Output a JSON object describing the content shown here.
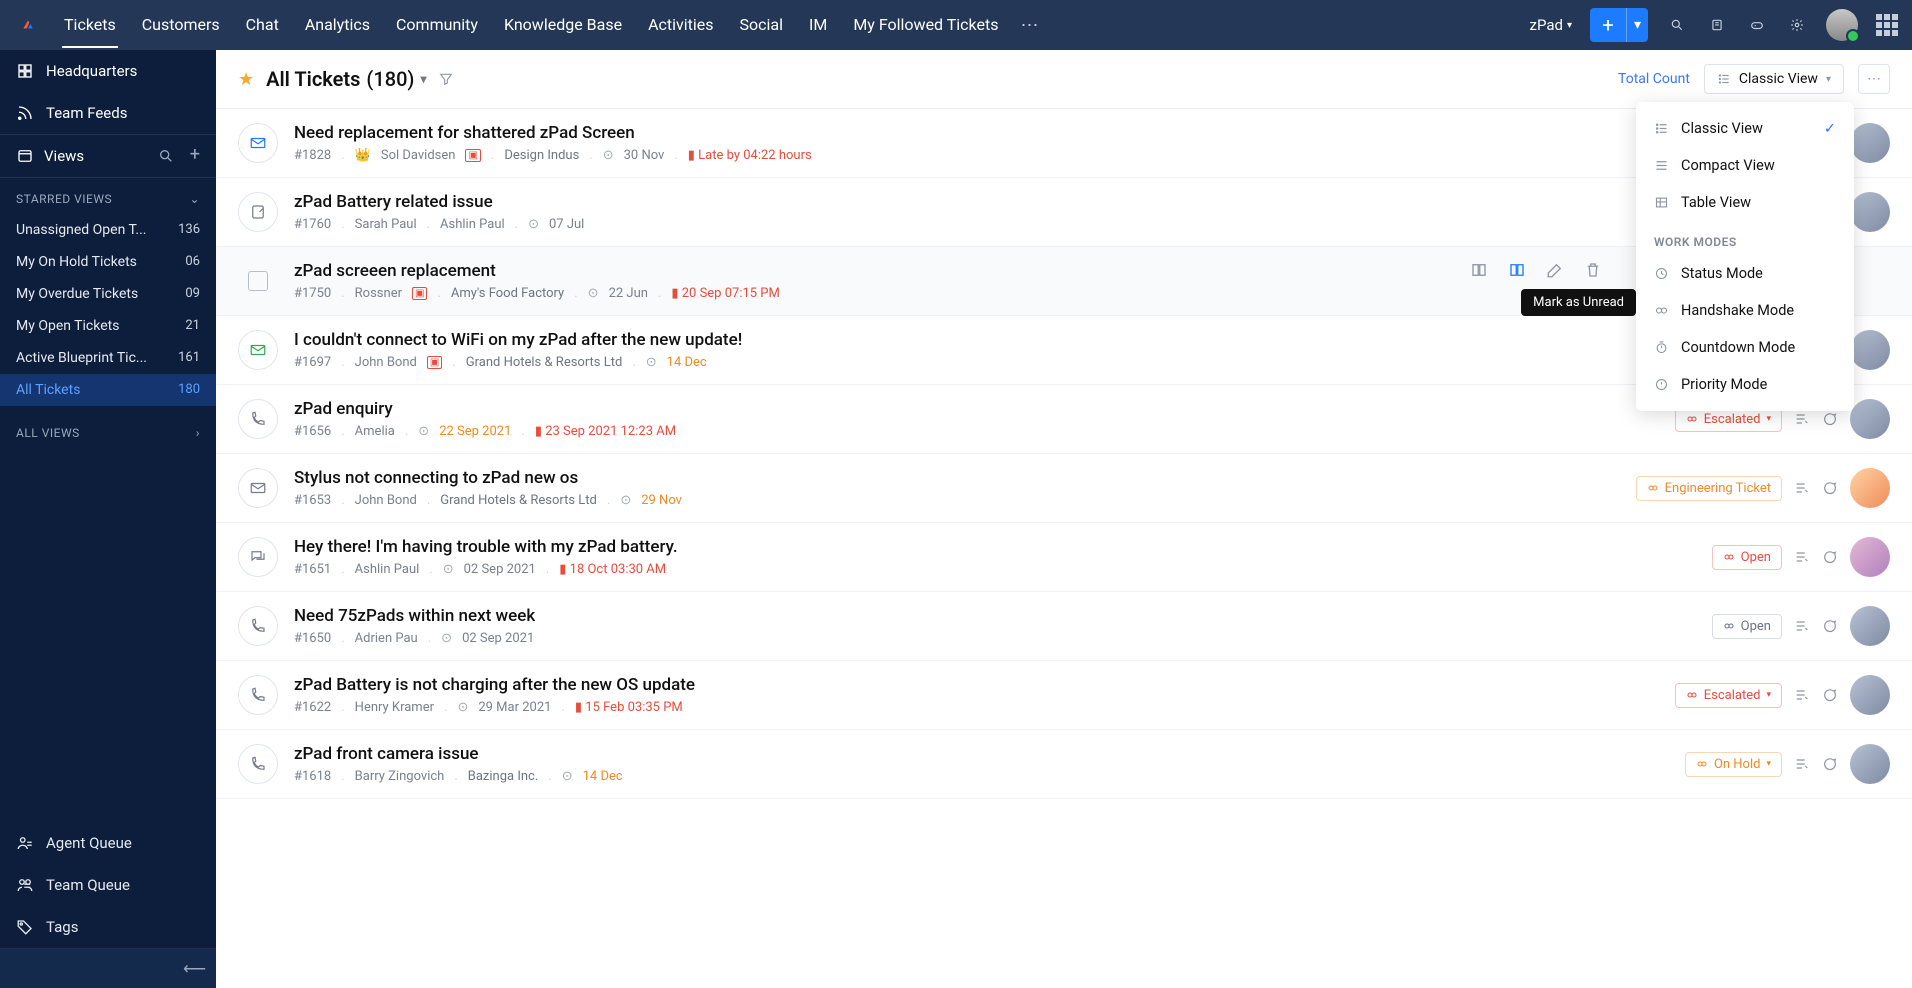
{
  "topnav": [
    "Tickets",
    "Customers",
    "Chat",
    "Analytics",
    "Community",
    "Knowledge Base",
    "Activities",
    "Social",
    "IM",
    "My Followed Tickets"
  ],
  "department": "zPad",
  "sidebar": {
    "hq": "Headquarters",
    "teamfeeds": "Team Feeds",
    "views": "Views",
    "starred_title": "STARRED VIEWS",
    "allviews_title": "ALL VIEWS",
    "starred": [
      {
        "label": "Unassigned Open T...",
        "count": "136"
      },
      {
        "label": "My On Hold Tickets",
        "count": "06"
      },
      {
        "label": "My Overdue Tickets",
        "count": "09"
      },
      {
        "label": "My Open Tickets",
        "count": "21"
      },
      {
        "label": "Active Blueprint Tic...",
        "count": "161"
      },
      {
        "label": "All Tickets",
        "count": "180",
        "active": true
      }
    ],
    "bottom": {
      "agentq": "Agent Queue",
      "teamq": "Team Queue",
      "tags": "Tags"
    }
  },
  "header": {
    "title": "All Tickets",
    "count": "(180)",
    "totalcount": "Total Count",
    "viewbtn": "Classic View"
  },
  "dropdown": {
    "classic": "Classic View",
    "compact": "Compact View",
    "table": "Table View",
    "work_title": "WORK MODES",
    "status": "Status Mode",
    "handshake": "Handshake Mode",
    "countdown": "Countdown Mode",
    "priority": "Priority Mode"
  },
  "tooltip": "Mark as Unread",
  "tickets": [
    {
      "icon": "mail-blue",
      "subj": "Need replacement for shattered zPad Screen",
      "id": "#1828",
      "vip": true,
      "person": "Sol Davidsen",
      "pflag": true,
      "org": "Design Indus",
      "date": "30 Nov",
      "due": "Late by 04:22 hours"
    },
    {
      "icon": "note",
      "subj": "zPad Battery related issue",
      "id": "#1760",
      "person": "Sarah Paul",
      "extra": "Ashlin Paul",
      "date": "07 Jul"
    },
    {
      "icon": "check",
      "hovered": true,
      "subj": "zPad screeen replacement",
      "id": "#1750",
      "person": "Rossner",
      "pflag": true,
      "org": "Amy's Food Factory",
      "date": "22 Jun",
      "due": "20 Sep 07:15 PM",
      "tools": true
    },
    {
      "icon": "mail-green",
      "subj": "I couldn't connect to WiFi on my zPad after the new update!",
      "id": "#1697",
      "person": "John Bond",
      "pflag": true,
      "org": "Grand Hotels & Resorts Ltd",
      "date": "14 Dec",
      "dateclr": "orange"
    },
    {
      "icon": "phone",
      "subj": "zPad enquiry",
      "id": "#1656",
      "person": "Amelia",
      "date": "22 Sep 2021",
      "dateclr": "orange",
      "due": "23 Sep 2021 12:23 AM",
      "badge": "Escalated",
      "badgecls": "escalated",
      "drop": true
    },
    {
      "icon": "mail",
      "subj": "Stylus not connecting to zPad new os",
      "id": "#1653",
      "person": "John Bond",
      "org": "Grand Hotels & Resorts Ltd",
      "date": "29 Nov",
      "dateclr": "orange",
      "badge": "Engineering Ticket",
      "badgecls": "eng",
      "avatarcls": "f1"
    },
    {
      "icon": "chat",
      "subj": "Hey there! I'm having trouble with my zPad battery.",
      "id": "#1651",
      "person": "Ashlin Paul",
      "date": "02 Sep 2021",
      "due": "18 Oct 03:30 AM",
      "badge": "Open",
      "badgecls": "open",
      "avatarcls": "f2"
    },
    {
      "icon": "phone",
      "subj": "Need 75zPads within next week",
      "id": "#1650",
      "person": "Adrien Pau",
      "date": "02 Sep 2021",
      "badge": "Open",
      "badgecls": "open-grey"
    },
    {
      "icon": "phone",
      "subj": "zPad Battery is not charging after the new OS update",
      "id": "#1622",
      "person": "Henry Kramer",
      "date": "29 Mar 2021",
      "due": "15 Feb 03:35 PM",
      "badge": "Escalated",
      "badgecls": "escalated",
      "drop": true
    },
    {
      "icon": "phone",
      "subj": "zPad front camera issue",
      "id": "#1618",
      "person": "Barry Zingovich",
      "org": "Bazinga Inc.",
      "date": "14 Dec",
      "dateclr": "orange",
      "badge": "On Hold",
      "badgecls": "hold",
      "drop": true
    }
  ]
}
